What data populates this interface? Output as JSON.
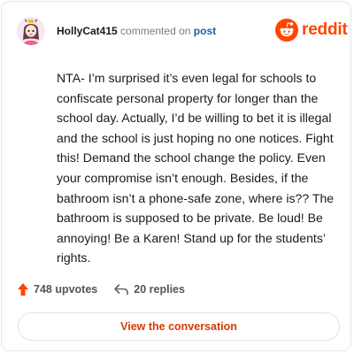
{
  "header": {
    "username": "HollyCat415",
    "action_text": "commented on",
    "post_link": "post"
  },
  "brand": {
    "wordmark": "reddit",
    "icon": "reddit-alien-icon",
    "color": "#ff4500"
  },
  "comment": {
    "body": "NTA- I’m surprised it’s even legal for schools to confiscate personal property for longer than the school day. Actually, I’d be willing to bet it is illegal and the school is just hoping no one notices. Fight this! Demand the school change the policy. Even your compromise isn’t enough. Besides, if the bathroom isn’t a phone-safe zone, where is?? The bathroom is supposed to be private. Be loud! Be annoying! Be a Karen! Stand up for the students’ rights."
  },
  "stats": {
    "upvotes": "748 upvotes",
    "upvote_icon": "upvote-arrow-icon",
    "replies": "20 replies",
    "reply_icon": "reply-arrow-icon"
  },
  "actions": {
    "view_conversation": "View the conversation"
  },
  "colors": {
    "accent": "#ff4500",
    "link": "#1c5fa8",
    "button_text": "#d93a00"
  }
}
